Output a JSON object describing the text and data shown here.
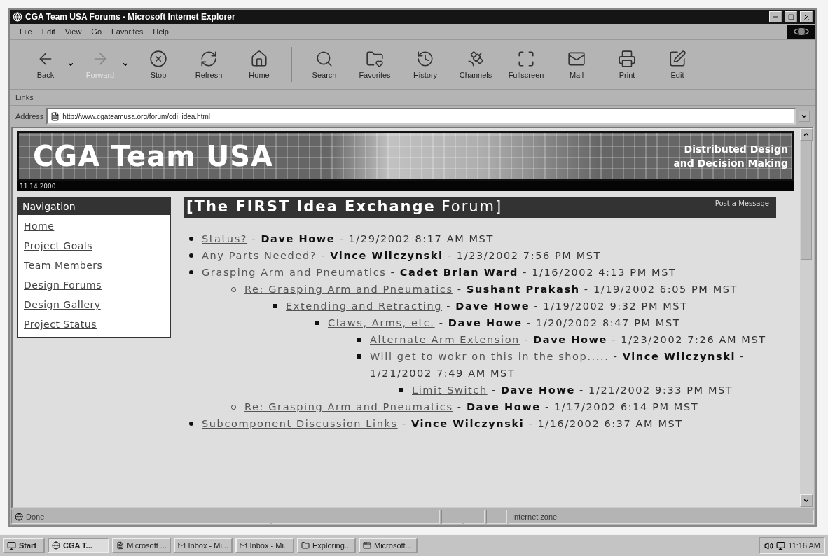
{
  "window": {
    "title": "CGA Team USA Forums - Microsoft Internet Explorer"
  },
  "menu": [
    "File",
    "Edit",
    "View",
    "Go",
    "Favorites",
    "Help"
  ],
  "toolbar": [
    {
      "label": "Back",
      "kind": "dropdown",
      "disabled": false
    },
    {
      "label": "Forward",
      "kind": "dropdown",
      "disabled": true
    },
    {
      "label": "Stop",
      "kind": "button",
      "disabled": false
    },
    {
      "label": "Refresh",
      "kind": "button",
      "disabled": false
    },
    {
      "label": "Home",
      "kind": "button",
      "disabled": false
    },
    {
      "label": "Search",
      "kind": "button",
      "disabled": false
    },
    {
      "label": "Favorites",
      "kind": "button",
      "disabled": false
    },
    {
      "label": "History",
      "kind": "button",
      "disabled": false
    },
    {
      "label": "Channels",
      "kind": "button",
      "disabled": false
    },
    {
      "label": "Fullscreen",
      "kind": "button",
      "disabled": false
    },
    {
      "label": "Mail",
      "kind": "button",
      "disabled": false
    },
    {
      "label": "Print",
      "kind": "button",
      "disabled": false
    },
    {
      "label": "Edit",
      "kind": "button",
      "disabled": false
    }
  ],
  "links_bar": {
    "label": "Links"
  },
  "address": {
    "label": "Address",
    "value": "http://www.cgateamusa.org/forum/cdi_idea.html"
  },
  "page": {
    "banner": {
      "title": "CGA Team USA",
      "tagline": [
        "Distributed Design",
        "and Decision Making"
      ],
      "date": "11.14.2000"
    },
    "navigation": {
      "heading": "Navigation",
      "links": [
        "Home",
        "Project Goals",
        "Team Members",
        "Design Forums",
        "Design Gallery",
        "Project Status"
      ]
    },
    "forum": {
      "heading": "**[The FIRST Idea Exchange** Forum]",
      "post_link": "Post a Message",
      "posts": [
        {
          "title": "Status?",
          "meta": "- **Dave Howe** - 1/29/2002 8:17 AM MST"
        },
        {
          "title": "Any Parts Needed?",
          "meta": "- **Vince Wilczynski** - 1/23/2002 7:56 PM MST"
        },
        {
          "title": "Grasping Arm and Pneumatics",
          "meta": "- **Cadet Brian Ward** - 1/16/2002 4:13 PM MST",
          "children": [
            {
              "title": "Re: Grasping Arm and Pneumatics",
              "meta": "- **Sushant Prakash** - 1/19/2002 6:05 PM MST",
              "children": [
                {
                  "title": "Extending and Retracting",
                  "meta": "- **Dave Howe** - 1/19/2002 9:32 PM MST",
                  "children": [
                    {
                      "title": "Claws, Arms, etc.",
                      "meta": "- **Dave Howe** - 1/20/2002 8:47 PM MST",
                      "children": [
                        {
                          "title": "Alternate Arm Extension",
                          "meta": "- **Dave Howe** - 1/23/2002 7:26 AM MST"
                        },
                        {
                          "title": "Will get to wokr on this in the shop.....",
                          "meta": "- **Vince Wilczynski** - 1/21/2002 7:49 AM MST",
                          "children": [
                            {
                              "title": "Limit Switch",
                              "meta": "- **Dave Howe** - 1/21/2002 9:33 PM MST"
                            }
                          ]
                        }
                      ]
                    }
                  ]
                }
              ]
            },
            {
              "title": "Re: Grasping Arm and Pneumatics",
              "meta": "- **Dave Howe** - 1/17/2002 6:14 PM MST"
            }
          ]
        },
        {
          "title": "Subcomponent Discussion Links",
          "meta": "- **Vince Wilczynski** - 1/16/2002 6:37 AM MST"
        }
      ]
    }
  },
  "status_bar": {
    "text": "Done",
    "zone": "Internet zone"
  },
  "taskbar": {
    "start": "Start",
    "buttons": [
      {
        "label": "CGA T...",
        "selected": true
      },
      {
        "label": "Microsoft ...",
        "selected": false
      },
      {
        "label": "Inbox - Mi...",
        "selected": false
      },
      {
        "label": "Inbox - Mi...",
        "selected": false
      },
      {
        "label": "Exploring...",
        "selected": false
      },
      {
        "label": "Microsoft...",
        "selected": false
      }
    ],
    "clock": "11:16 AM"
  }
}
